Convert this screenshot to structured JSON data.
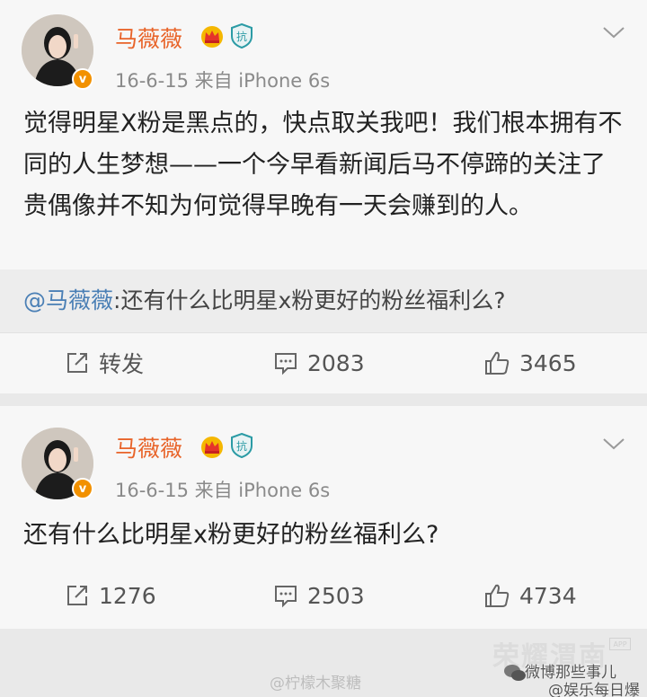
{
  "post1": {
    "author": "马薇薇",
    "meta": "16-6-15  来自 iPhone 6s",
    "text": "觉得明星X粉是黑点的，快点取关我吧！我们根本拥有不同的人生梦想——一个今早看新闻后马不停蹄的关注了贵偶像并不知为何觉得早晚有一天会赚到的人。",
    "repost": {
      "at": "@马薇薇",
      "text": ":还有什么比明星x粉更好的粉丝福利么?"
    },
    "actions": {
      "repost": "转发",
      "comments": "2083",
      "likes": "3465"
    }
  },
  "post2": {
    "author": "马薇薇",
    "meta": "16-6-15  来自 iPhone 6s",
    "text": "还有什么比明星x粉更好的粉丝福利么?",
    "actions": {
      "repost": "1276",
      "comments": "2503",
      "likes": "4734"
    }
  },
  "badges": {
    "verified": "v",
    "shield": "抗"
  },
  "watermarks": {
    "brand": "荣耀渭南",
    "brand_tag": "APP",
    "credit": "@柠檬木聚糖",
    "account1": "微博那些事儿",
    "account2": "@娱乐每日爆"
  },
  "colors": {
    "name": "#e8642a",
    "link": "#4a7fb5",
    "verified": "#f29100"
  }
}
